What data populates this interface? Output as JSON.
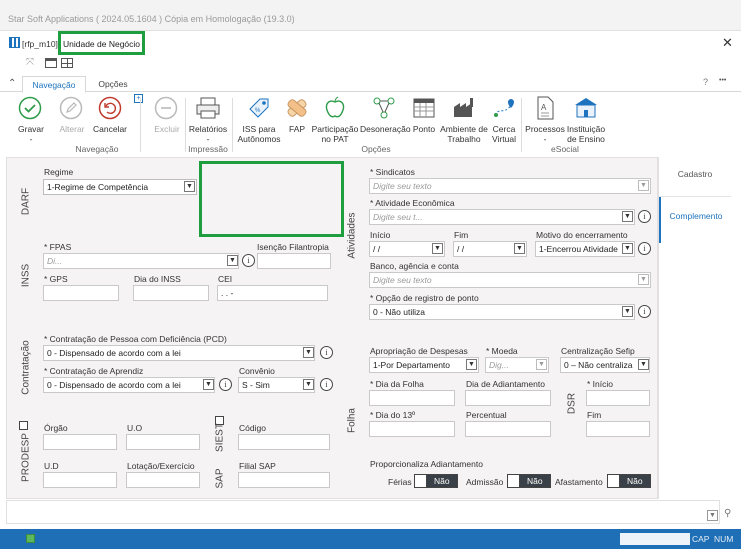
{
  "app_title": "Star Soft Applications ( 2024.05.1604 )  Cópia em Homologação (19.3.0)",
  "doc": {
    "code": "[rfp_m10]",
    "title": "Unidade de Negócio"
  },
  "ribbon": {
    "tabs": [
      "Navegação",
      "Opções"
    ],
    "help": "?",
    "more": "•••",
    "buttons": {
      "gravar": "Gravar",
      "gravar_arrow": "-",
      "alterar": "Alterar",
      "cancelar": "Cancelar",
      "excluir": "Excluir",
      "relatorios": "Relatórios",
      "relatorios_arrow": "-",
      "iss": [
        "ISS para",
        "Autônomos"
      ],
      "fap": "FAP",
      "participacao": [
        "Participação",
        "no PAT"
      ],
      "desoneracao": "Desoneração",
      "ponto": "Ponto",
      "ambiente": [
        "Ambiente de",
        "Trabalho"
      ],
      "cerca": [
        "Cerca",
        "Virtual"
      ],
      "processos": "Processos",
      "processos_arrow": "-",
      "instituicao": [
        "Instituição",
        "de Ensino"
      ]
    },
    "groups": {
      "navegacao": "Navegação",
      "impressao": "Impressão",
      "opcoes": "Opções",
      "esocial": "eSocial"
    }
  },
  "side_tabs": [
    "Cadastro",
    "Complemento"
  ],
  "sections": {
    "darf": "DARF",
    "inss": "INSS",
    "contratacao": "Contratação",
    "prodesp": "PRODESP",
    "siest": "SIEST",
    "sap": "SAP",
    "atividades": "Atividades",
    "folha": "Folha",
    "dsr": "DSR"
  },
  "form": {
    "regime_label": "Regime",
    "regime_value": "1-Regime de Competência",
    "fpas_label": "* FPAS",
    "fpas_placeholder": "Di...",
    "isencao_label": "Isenção Filantropia",
    "gps_label": "* GPS",
    "dia_inss_label": "Dia do INSS",
    "cei_label": "CEI",
    "cei_value": "  .   .   -",
    "pcd_label": "* Contratação de Pessoa com Deficiência (PCD)",
    "pcd_value": "0 - Dispensado de acordo com a lei",
    "aprendiz_label": "* Contratação de Aprendiz",
    "aprendiz_value": "0 - Dispensado de acordo com a lei",
    "convenio_label": "Convênio",
    "convenio_value": "S - Sim",
    "orgao_label": "Órgão",
    "uo_label": "U.O",
    "codigo_label": "Código",
    "ud_label": "U.D",
    "lotacao_label": "Lotação/Exercício",
    "filial_sap_label": "Filial SAP",
    "sindicatos_label": "* Sindicatos",
    "sindicatos_placeholder": "Digite seu texto",
    "atividade_label": "* Atividade Econômica",
    "atividade_placeholder": "Digite seu t...",
    "inicio_label": "Início",
    "inicio_value": " /  /",
    "fim_label": "Fim",
    "fim_value": " /  /",
    "motivo_label": "Motivo do encerramento",
    "motivo_value": "1-Encerrou Atividade",
    "banco_label": "Banco, agência e conta",
    "banco_placeholder": "Digite seu texto",
    "registro_ponto_label": "* Opção de registro de ponto",
    "registro_ponto_value": "0 - Não utiliza",
    "apropriacao_label": "Apropriação de Despesas",
    "apropriacao_value": "1-Por Departamento",
    "moeda_label": "* Moeda",
    "moeda_placeholder": "Dig...",
    "sefip_label": "Centralização Sefip",
    "sefip_value": "0 – Não centraliza",
    "dia_folha_label": "* Dia da Folha",
    "dia_adiantamento_label": "Dia de Adiantamento",
    "dsr_inicio_label": "* Início",
    "dia_13_label": "* Dia do 13º",
    "percentual_label": "Percentual",
    "dsr_fim_label": "Fim",
    "proporcionaliza_label": "Proporcionaliza Adiantamento",
    "ferias_label": "Férias",
    "ferias_value": "Não",
    "admissao_label": "Admissão",
    "admissao_value": "Não",
    "afastamento_label": "Afastamento",
    "afastamento_value": "Não"
  },
  "status": {
    "cap": "CAP",
    "num": "NUM"
  },
  "colors": {
    "accent": "#1e73be",
    "highlight": "#1f9e40",
    "statusbar": "#1e6fb5",
    "panel": "#f6f3f5"
  }
}
